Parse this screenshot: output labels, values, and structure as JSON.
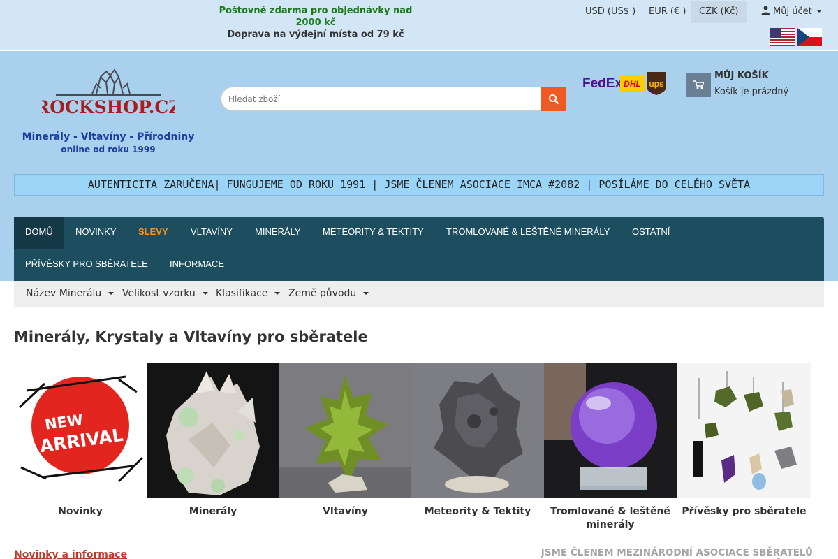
{
  "promo": {
    "line1": "Poštovné zdarma pro objednávky nad 2000 kč",
    "line2": "Doprava na výdejní místa od 79 kč"
  },
  "currencies": [
    {
      "label": "USD (US$ )",
      "active": false
    },
    {
      "label": "EUR (€ )",
      "active": false
    },
    {
      "label": "CZK (Kč)",
      "active": true
    }
  ],
  "account": {
    "label": "Můj účet",
    "icon": "user-icon"
  },
  "flags": [
    "us-flag",
    "cz-flag"
  ],
  "logo": {
    "text": "ROCKSHOP.CZ"
  },
  "tagline": {
    "line1": "Minerály - Vltavíny - Přírodniny",
    "line2": "online od roku 1999"
  },
  "search": {
    "placeholder": "Hledat zboží",
    "icon": "search-icon"
  },
  "carriers": {
    "fedex": "FedEx",
    "dhl": "DHL",
    "ups": "ups"
  },
  "cart": {
    "title": "MŮJ KOŠÍK",
    "status": "Košík je prázdný",
    "icon": "cart-icon"
  },
  "banner": "AUTENTICITA ZARUČENA| FUNGUJEME OD ROKU 1991 | JSME ČLENEM ASOCIACE IMCA #2082 | POSÍLÁME DO CELÉHO SVĚTA",
  "nav": [
    {
      "label": "DOMŮ",
      "active": true
    },
    {
      "label": "NOVINKY"
    },
    {
      "label": "SLEVY",
      "highlight": true
    },
    {
      "label": "VLTAVÍNY"
    },
    {
      "label": "MINERÁLY"
    },
    {
      "label": "METEORITY & TEKTITY"
    },
    {
      "label": "TROMLOVANÉ & LEŠTĚNÉ MINERÁLY"
    },
    {
      "label": "OSTATNÍ"
    },
    {
      "label": "PŘÍVĚSKY PRO SBĚRATELE"
    },
    {
      "label": "INFORMACE"
    }
  ],
  "filters": [
    "Název Minerálu",
    "Velikost vzorku",
    "Klasifikace",
    "Země původu"
  ],
  "main": {
    "title": "Minerály, Krystaly a Vltavíny pro sběratele",
    "new_arrival_badge": {
      "line1": "NEW",
      "line2": "ARRIVAL"
    },
    "categories": [
      {
        "label": "Novinky"
      },
      {
        "label": "Minerály"
      },
      {
        "label": "Vltavíny"
      },
      {
        "label": "Meteority & Tektity"
      },
      {
        "label": "Tromlované & leštěné minerály"
      },
      {
        "label": "Přívěsky pro sběratele"
      }
    ]
  },
  "bottom": {
    "news_link": "Novinky a informace",
    "imca_heading": "JSME ČLENEM MEZINÁRODNÍ ASOCIACE SBĚRATELŮ METEORITŮ IMCA"
  },
  "colors": {
    "topbar": "#d3e6f6",
    "header": "#a9d0ec",
    "nav": "#1d4e60",
    "sale": "#f7931e",
    "search_button": "#f05a22",
    "promo_green": "#1c7c1c",
    "tagline_blue": "#1b3fa0"
  }
}
